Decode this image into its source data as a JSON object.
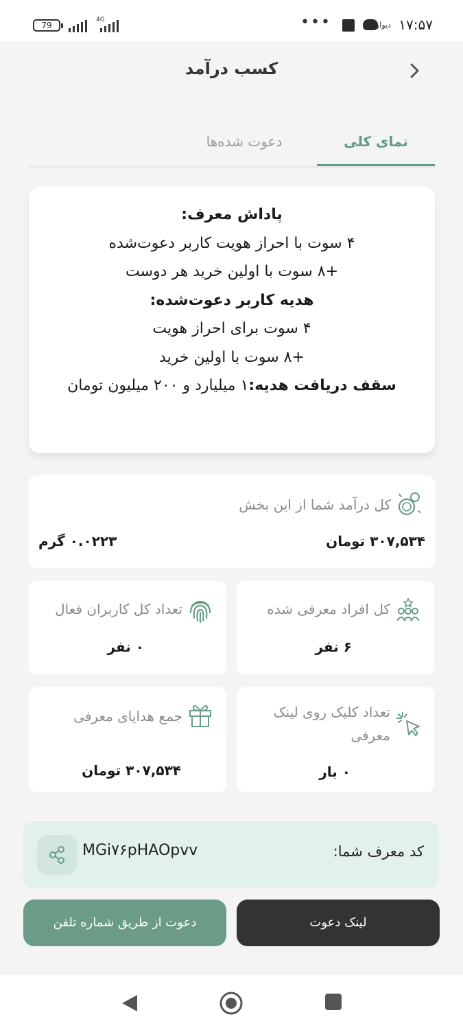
{
  "status_bar": {
    "time": "۱۷:۵۷",
    "brand": "دیوار",
    "battery": "79",
    "network": "4G",
    "more": "•••"
  },
  "header": {
    "title": "کسب درآمد"
  },
  "tabs": [
    {
      "label": "نمای کلی",
      "active": true
    },
    {
      "label": "دعوت شده‌ها",
      "active": false
    }
  ],
  "info": {
    "referrer_title": "پاداش معرف:",
    "referrer_line1": "۴ سوت با احراز هویت کاربر دعوت‌شده",
    "referrer_line2": "+۸ سوت با اولین خرید هر دوست",
    "invitee_title": "هدیه کاربر دعوت‌شده:",
    "invitee_line1": "۴ سوت برای احراز هویت",
    "invitee_line2": "+۸ سوت با اولین خرید",
    "cap_label": "سقف دریافت هدیه:",
    "cap_value": "۱ میلیارد و ۲۰۰ میلیون تومان"
  },
  "stats": {
    "total": {
      "label": "کل درآمد شما از این بخش",
      "value_toman": "۳۰۷,۵۳۴ تومان",
      "value_gram": "۰.۰۲۲۳ گرم",
      "icon": "coins-icon"
    },
    "referred": {
      "label": "کل افراد معرفی شده",
      "value": "۶ نفر",
      "icon": "people-icon"
    },
    "active": {
      "label": "تعداد کل کاربران فعال",
      "value": "۰ نفر",
      "icon": "fingerprint-icon"
    },
    "clicks": {
      "label": "تعداد کلیک روی لینک معرفی",
      "value": "۰ بار",
      "icon": "cursor-click-icon"
    },
    "gifts": {
      "label": "جمع هدایای معرفی",
      "value": "۳۰۷,۵۳۴ تومان",
      "icon": "gift-icon"
    }
  },
  "referral": {
    "label": "کد معرف شما:",
    "code": "MGi۷۶pHAOpvv"
  },
  "buttons": {
    "invite_link": "لینک دعوت",
    "invite_phone": "دعوت از طریق شماره تلفن"
  },
  "colors": {
    "accent": "#5f9b82",
    "dark_button": "#333333",
    "green_button": "#6a9c86",
    "code_bg": "#e3f1ec"
  }
}
